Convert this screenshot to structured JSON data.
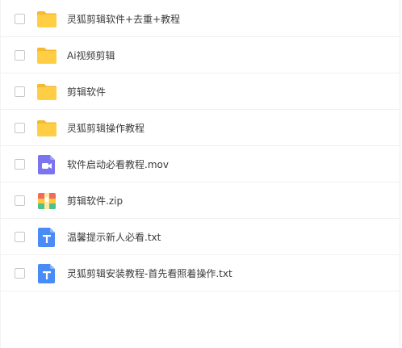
{
  "files": [
    {
      "name": "灵狐剪辑软件+去重+教程",
      "icon": "folder-icon"
    },
    {
      "name": "Ai视频剪辑",
      "icon": "folder-icon"
    },
    {
      "name": "剪辑软件",
      "icon": "folder-icon"
    },
    {
      "name": "灵狐剪辑操作教程",
      "icon": "folder-icon"
    },
    {
      "name": "软件启动必看教程.mov",
      "icon": "video-file-icon"
    },
    {
      "name": "剪辑软件.zip",
      "icon": "zip-file-icon"
    },
    {
      "name": "温馨提示新人必看.txt",
      "icon": "text-file-icon"
    },
    {
      "name": "灵狐剪辑安装教程-首先看照着操作.txt",
      "icon": "text-file-icon"
    }
  ],
  "colors": {
    "folder": "#FFCE45",
    "folder_tab": "#F5B82E",
    "video": "#7B73F0",
    "text_file": "#4A8CF7",
    "zip_red": "#F06B5B",
    "zip_yellow": "#FFC83D",
    "zip_green": "#4CC38A"
  }
}
